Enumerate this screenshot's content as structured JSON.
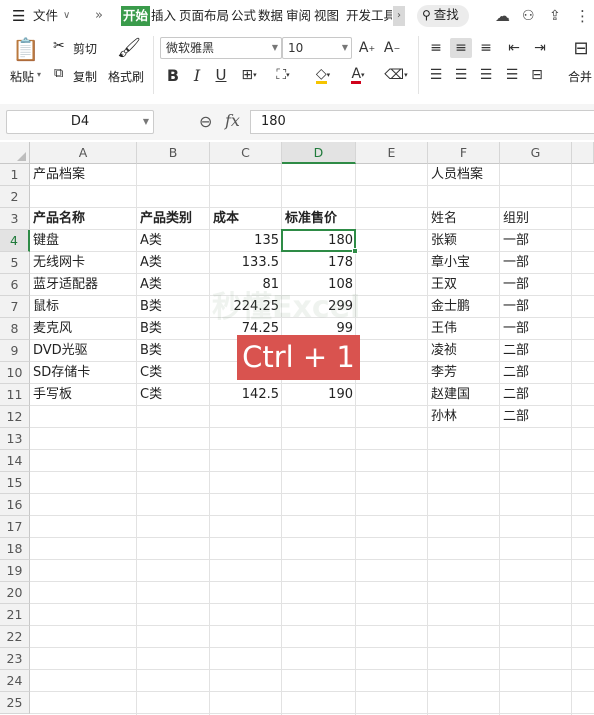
{
  "menubar": {
    "file": "文件",
    "tabs": [
      "开始",
      "插入",
      "页面布局",
      "公式",
      "数据",
      "审阅",
      "视图",
      "开发工具"
    ],
    "search": "查找"
  },
  "ribbon": {
    "paste": "粘贴",
    "cut": "剪切",
    "copy": "复制",
    "format_painter": "格式刷",
    "font_name": "微软雅黑",
    "font_size": "10",
    "merge": "合并"
  },
  "formula_bar": {
    "name_box": "D4",
    "fx": "fx",
    "value": "180"
  },
  "columns": [
    "A",
    "B",
    "C",
    "D",
    "E",
    "F",
    "G"
  ],
  "rows": [
    "1",
    "2",
    "3",
    "4",
    "5",
    "6",
    "7",
    "8",
    "9",
    "10",
    "11",
    "12",
    "13",
    "14",
    "15",
    "16",
    "17",
    "18",
    "19",
    "20",
    "21",
    "22",
    "23",
    "24",
    "25"
  ],
  "cells": {
    "A1": "产品档案",
    "F1": "人员档案",
    "A3": "产品名称",
    "B3": "产品类别",
    "C3": "成本",
    "D3": "标准售价",
    "F3": "姓名",
    "G3": "组别",
    "A4": "键盘",
    "B4": "A类",
    "C4": "135",
    "D4": "180",
    "F4": "张颖",
    "G4": "一部",
    "A5": "无线网卡",
    "B5": "A类",
    "C5": "133.5",
    "D5": "178",
    "F5": "章小宝",
    "G5": "一部",
    "A6": "蓝牙适配器",
    "B6": "A类",
    "C6": "81",
    "D6": "108",
    "F6": "王双",
    "G6": "一部",
    "A7": "鼠标",
    "B7": "B类",
    "C7": "224.25",
    "D7": "299",
    "F7": "金士鹏",
    "G7": "一部",
    "A8": "麦克风",
    "B8": "B类",
    "C8": "74.25",
    "D8": "99",
    "F8": "王伟",
    "G8": "一部",
    "A9": "DVD光驱",
    "B9": "B类",
    "F9": "凌祯",
    "G9": "二部",
    "A10": "SD存储卡",
    "B10": "C类",
    "F10": "李芳",
    "G10": "二部",
    "A11": "手写板",
    "B11": "C类",
    "C11": "142.5",
    "D11": "190",
    "F11": "赵建国",
    "G11": "二部",
    "F12": "孙林",
    "G12": "二部"
  },
  "overlay": {
    "shortcut": "Ctrl + 1",
    "watermark": "秒懂Excel"
  },
  "colors": {
    "accent": "#2e8b46",
    "overlay_bg": "#d9534f"
  }
}
